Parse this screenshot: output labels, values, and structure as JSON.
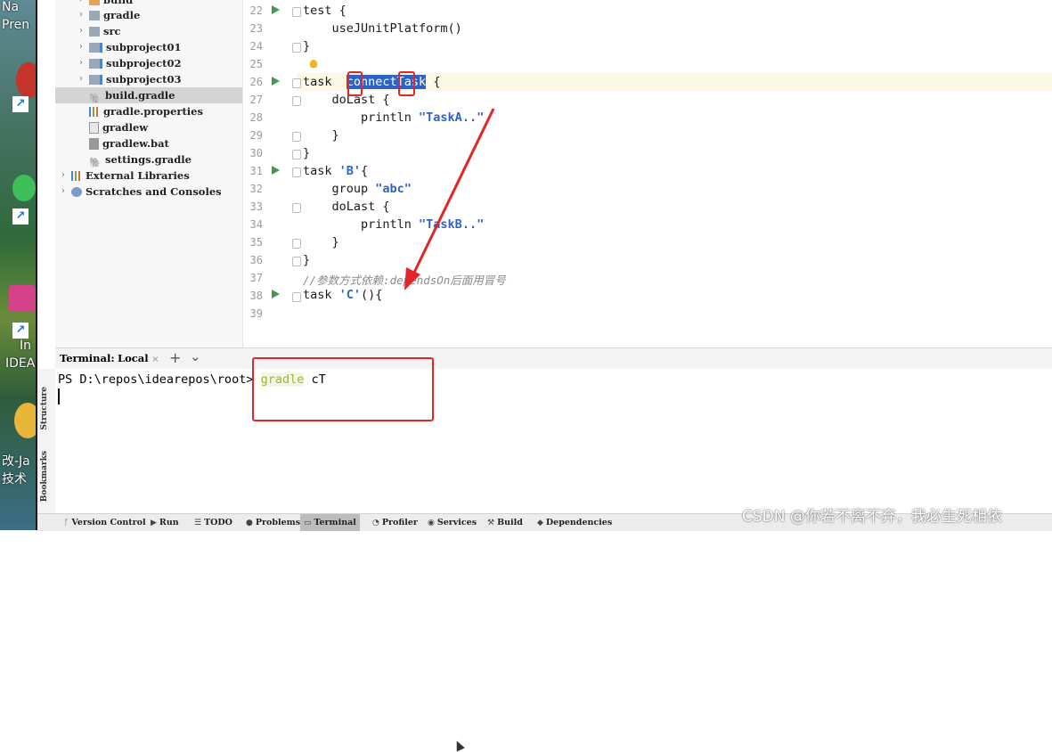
{
  "desktop": {
    "fragments": [
      "Na",
      "Pren",
      "In",
      "IDEA",
      "改-Ja",
      "技术"
    ]
  },
  "project_tree": {
    "items": [
      {
        "label": "build",
        "icon": "folder-orange-icon",
        "chevron": true
      },
      {
        "label": "gradle",
        "icon": "folder-icon",
        "chevron": true
      },
      {
        "label": "src",
        "icon": "folder-icon",
        "chevron": true
      },
      {
        "label": "subproject01",
        "icon": "module-icon",
        "chevron": true
      },
      {
        "label": "subproject02",
        "icon": "module-icon",
        "chevron": true
      },
      {
        "label": "subproject03",
        "icon": "module-icon",
        "chevron": true
      },
      {
        "label": "build.gradle",
        "icon": "gradle-file-icon",
        "chevron": false,
        "selected": true
      },
      {
        "label": "gradle.properties",
        "icon": "properties-file-icon",
        "chevron": false
      },
      {
        "label": "gradlew",
        "icon": "script-file-icon",
        "chevron": false
      },
      {
        "label": "gradlew.bat",
        "icon": "batch-file-icon",
        "chevron": false
      },
      {
        "label": "settings.gradle",
        "icon": "gradle-file-icon",
        "chevron": false
      },
      {
        "label": "External Libraries",
        "icon": "libraries-icon",
        "chevron": true,
        "root": true
      },
      {
        "label": "Scratches and Consoles",
        "icon": "scratches-icon",
        "chevron": true,
        "root": true
      }
    ]
  },
  "editor": {
    "lines": [
      {
        "num": "22",
        "text": "test {"
      },
      {
        "num": "23",
        "text": "    useJUnitPlatform()"
      },
      {
        "num": "24",
        "text": "}"
      },
      {
        "num": "25",
        "text": ""
      },
      {
        "num": "26",
        "pre": "task  ",
        "sel": "connectTask",
        "post": " {"
      },
      {
        "num": "27",
        "text": "    doLast {"
      },
      {
        "num": "28",
        "pre": "        println ",
        "str": "\"TaskA..\""
      },
      {
        "num": "29",
        "text": "    }"
      },
      {
        "num": "30",
        "text": "}"
      },
      {
        "num": "31",
        "pre": "task ",
        "str": "'B'",
        "post": "{"
      },
      {
        "num": "32",
        "pre": "    group ",
        "str": "\"abc\""
      },
      {
        "num": "33",
        "text": "    doLast {"
      },
      {
        "num": "34",
        "pre": "        println ",
        "str": "\"TaskB..\""
      },
      {
        "num": "35",
        "text": "    }"
      },
      {
        "num": "36",
        "text": "}"
      },
      {
        "num": "37",
        "comment": "//参数方式依赖:dependsOn后面用冒号"
      },
      {
        "num": "38",
        "pre": "task ",
        "str": "'C'",
        "post": "(){"
      },
      {
        "num": "39",
        "text": ""
      }
    ]
  },
  "terminal": {
    "header_label": "Terminal:",
    "tab_label": "Local",
    "close_glyph": "×",
    "add_glyph": "+",
    "dropdown_glyph": "⌄",
    "prompt": "PS D:\\repos\\idearepos\\root> ",
    "command_word": "gradle",
    "command_arg": " cT"
  },
  "side_strip": {
    "structure": "Structure",
    "bookmarks": "Bookmarks"
  },
  "bottom_bar": {
    "items": [
      {
        "label": "Version Control",
        "icon": "branch-icon",
        "glyph": "ᚴ"
      },
      {
        "label": "Run",
        "icon": "run-icon",
        "glyph": "▶"
      },
      {
        "label": "TODO",
        "icon": "todo-icon",
        "glyph": "☰"
      },
      {
        "label": "Problems",
        "icon": "problems-icon",
        "glyph": "●"
      },
      {
        "label": "Terminal",
        "icon": "terminal-icon",
        "glyph": "▭",
        "active": true
      },
      {
        "label": "Profiler",
        "icon": "profiler-icon",
        "glyph": "◔"
      },
      {
        "label": "Services",
        "icon": "services-icon",
        "glyph": "◉"
      },
      {
        "label": "Build",
        "icon": "build-hammer-icon",
        "glyph": "⚒"
      },
      {
        "label": "Dependencies",
        "icon": "dependencies-icon",
        "glyph": "◆"
      }
    ]
  },
  "watermark": "CSDN @你若不离不弃，我必生死相依",
  "colors": {
    "accent": "#2d63c7",
    "annotation_red": "#e32525",
    "string": "#2f63c6",
    "run_green": "#3f9b4a"
  }
}
